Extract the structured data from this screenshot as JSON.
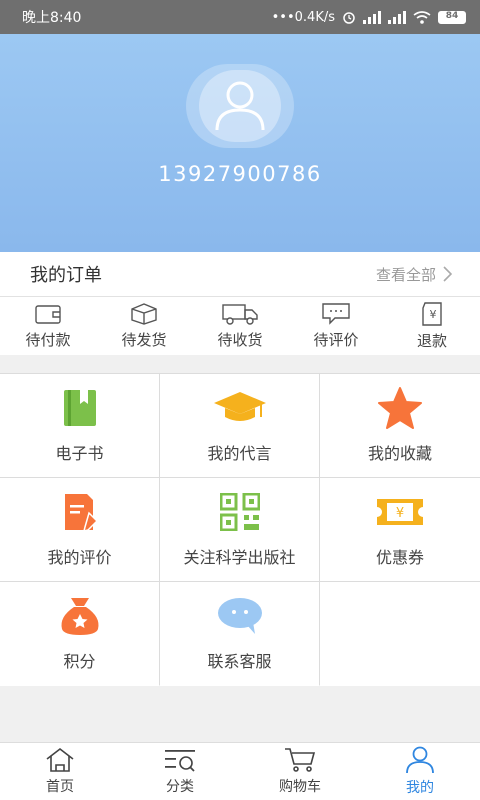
{
  "status_bar": {
    "time": "晚上8:40",
    "network": "•••0.4K/s",
    "battery": "84"
  },
  "profile": {
    "phone": "13927900786"
  },
  "orders": {
    "title": "我的订单",
    "view_all": "查看全部",
    "items": [
      {
        "label": "待付款",
        "icon": "wallet-icon"
      },
      {
        "label": "待发货",
        "icon": "package-icon"
      },
      {
        "label": "待收货",
        "icon": "truck-icon"
      },
      {
        "label": "待评价",
        "icon": "comment-icon"
      },
      {
        "label": "退款",
        "icon": "refund-icon"
      }
    ]
  },
  "grid": [
    {
      "label": "电子书",
      "icon": "ebook-icon",
      "color": "#7cc04a"
    },
    {
      "label": "我的代言",
      "icon": "graduation-cap-icon",
      "color": "#f5b11d"
    },
    {
      "label": "我的收藏",
      "icon": "star-icon",
      "color": "#f7743a"
    },
    {
      "label": "我的评价",
      "icon": "document-edit-icon",
      "color": "#f7743a"
    },
    {
      "label": "关注科学出版社",
      "icon": "qr-code-icon",
      "color": "#7cc04a"
    },
    {
      "label": "优惠券",
      "icon": "coupon-icon",
      "color": "#f5b11d"
    },
    {
      "label": "积分",
      "icon": "money-bag-icon",
      "color": "#f7743a"
    },
    {
      "label": "联系客服",
      "icon": "chat-bubble-icon",
      "color": "#9cc8f3"
    }
  ],
  "nav": [
    {
      "label": "首页",
      "icon": "home-icon"
    },
    {
      "label": "分类",
      "icon": "category-icon"
    },
    {
      "label": "购物车",
      "icon": "cart-icon"
    },
    {
      "label": "我的",
      "icon": "user-icon",
      "active": true
    }
  ],
  "colors": {
    "header": "#9cc8f3",
    "accent": "#2f86e0",
    "orange": "#f7743a",
    "green": "#7cc04a",
    "yellow": "#f5b11d"
  }
}
